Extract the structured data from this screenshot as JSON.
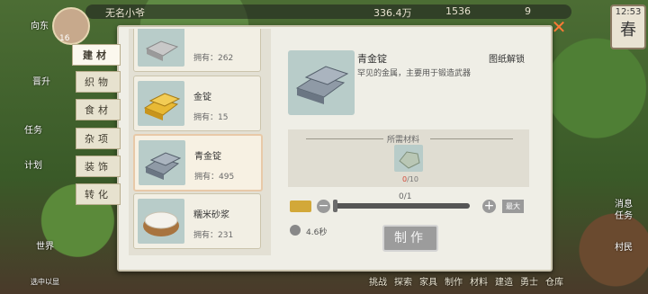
{
  "hud": {
    "player_name": "无名小爷",
    "level": "16",
    "res1": "336.4万",
    "res2": "1536",
    "res3": "9",
    "season_time": "12:53",
    "season": "春"
  },
  "side_labels": {
    "home": "向东",
    "upgrade": "晋升",
    "task": "任务",
    "plan": "计划",
    "world": "世界",
    "news": "消息",
    "activity": "任务",
    "village": "村民",
    "select": "选中以显"
  },
  "tabs": [
    "建材",
    "织物",
    "食材",
    "杂项",
    "装饰",
    "转化"
  ],
  "items": [
    {
      "name": "",
      "owned": "拥有：262"
    },
    {
      "name": "金锭",
      "owned": "拥有：15"
    },
    {
      "name": "青金锭",
      "owned": "拥有：495"
    },
    {
      "name": "糯米砂浆",
      "owned": "拥有：231"
    }
  ],
  "detail": {
    "name": "青金锭",
    "desc": "罕见的金属，主要用于锻造武器",
    "unlock": "图纸解锁",
    "mats_title": "所需材料",
    "have": "0",
    "need": "/10",
    "qty": "0/1",
    "max": "最大",
    "time": "4.6秒",
    "make": "制作"
  },
  "bottom_nav": [
    "挑战",
    "探索",
    "家具",
    "制作",
    "材料",
    "建造",
    "勇士",
    "仓库"
  ],
  "colors": {
    "accent": "#ff7a35",
    "panel": "#efeee6",
    "have_red": "#d24a3a"
  }
}
